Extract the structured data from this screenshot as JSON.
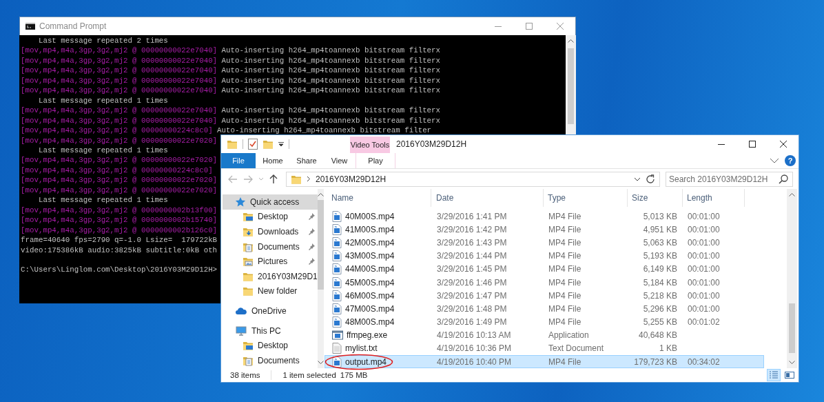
{
  "console": {
    "title": "Command Prompt",
    "lines": [
      {
        "kind": "message",
        "text": "    Last message repeated 2 times"
      },
      {
        "kind": "log",
        "source": "[mov,mp4,m4a,3gp,3g2,mj2 @ 00000000022e7040]",
        "message": "Auto-inserting h264_mp4toannexb bitstream filterx"
      },
      {
        "kind": "log",
        "source": "[mov,mp4,m4a,3gp,3g2,mj2 @ 00000000022e7040]",
        "message": "Auto-inserting h264_mp4toannexb bitstream filterx"
      },
      {
        "kind": "log",
        "source": "[mov,mp4,m4a,3gp,3g2,mj2 @ 00000000022e7040]",
        "message": "Auto-inserting h264_mp4toannexb bitstream filterx"
      },
      {
        "kind": "log",
        "source": "[mov,mp4,m4a,3gp,3g2,mj2 @ 00000000022e7040]",
        "message": "Auto-inserting h264_mp4toannexb bitstream filterx"
      },
      {
        "kind": "log",
        "source": "[mov,mp4,m4a,3gp,3g2,mj2 @ 00000000022e7040]",
        "message": "Auto-inserting h264_mp4toannexb bitstream filterx"
      },
      {
        "kind": "message",
        "text": "    Last message repeated 1 times"
      },
      {
        "kind": "log",
        "source": "[mov,mp4,m4a,3gp,3g2,mj2 @ 00000000022e7040]",
        "message": "Auto-inserting h264_mp4toannexb bitstream filterx"
      },
      {
        "kind": "log",
        "source": "[mov,mp4,m4a,3gp,3g2,mj2 @ 00000000022e7040]",
        "message": "Auto-inserting h264_mp4toannexb bitstream filterx"
      },
      {
        "kind": "log",
        "source": "[mov,mp4,m4a,3gp,3g2,mj2 @ 00000000224c8c0]",
        "message": "Auto-inserting h264_mp4toannexb bitstream filter"
      },
      {
        "kind": "log",
        "source": "[mov,mp4,m4a,3gp,3g2,mj2 @ 00000000022e7020]"
      },
      {
        "kind": "message",
        "text": "    Last message repeated 1 times"
      },
      {
        "kind": "log",
        "source": "[mov,mp4,m4a,3gp,3g2,mj2 @ 00000000022e7020]"
      },
      {
        "kind": "log",
        "source": "[mov,mp4,m4a,3gp,3g2,mj2 @ 00000000224c8c0]"
      },
      {
        "kind": "log",
        "source": "[mov,mp4,m4a,3gp,3g2,mj2 @ 00000000022e7020]"
      },
      {
        "kind": "log",
        "source": "[mov,mp4,m4a,3gp,3g2,mj2 @ 00000000022e7020]"
      },
      {
        "kind": "message",
        "text": "    Last message repeated 1 times"
      },
      {
        "kind": "log",
        "source": "[mov,mp4,m4a,3gp,3g2,mj2 @ 0000000002b13f00]"
      },
      {
        "kind": "log",
        "source": "[mov,mp4,m4a,3gp,3g2,mj2 @ 0000000002b15740]"
      },
      {
        "kind": "log",
        "source": "[mov,mp4,m4a,3gp,3g2,mj2 @ 0000000002b126c0]"
      },
      {
        "kind": "stats",
        "text": "frame=40640 fps=2790 q=-1.0 Lsize=  179722kB"
      },
      {
        "kind": "stats",
        "text": "video:175386kB audio:3825kB subtitle:0kB oth"
      },
      {
        "kind": "prompt",
        "text": "C:\\Users\\Linglom.com\\Desktop\\2016Y03M29D12H>"
      }
    ]
  },
  "explorer": {
    "title": "2016Y03M29D12H",
    "contextual_tab": "Video Tools",
    "ribbon_tabs": [
      {
        "label": "File",
        "kind": "file",
        "selected": false
      },
      {
        "label": "Home",
        "kind": "normal",
        "selected": false
      },
      {
        "label": "Share",
        "kind": "normal",
        "selected": false
      },
      {
        "label": "View",
        "kind": "normal",
        "selected": false
      },
      {
        "label": "Play",
        "kind": "contextual",
        "selected": false
      }
    ],
    "help_button": "?",
    "address": {
      "path": "2016Y03M29D12H"
    },
    "search": {
      "placeholder": "Search 2016Y03M29D12H"
    },
    "navigation": [
      {
        "label": "Quick access",
        "kind": "star",
        "selected": true,
        "children": [
          {
            "label": "Desktop",
            "kind": "desktop",
            "selected": false,
            "pinned": true
          },
          {
            "label": "Downloads",
            "kind": "downloads",
            "selected": false,
            "pinned": true
          },
          {
            "label": "Documents",
            "kind": "documents",
            "selected": false,
            "pinned": true
          },
          {
            "label": "Pictures",
            "kind": "pictures",
            "selected": false,
            "pinned": true
          },
          {
            "label": "2016Y03M29D1",
            "kind": "folder",
            "selected": false,
            "pinned": false
          },
          {
            "label": "New folder",
            "kind": "folder",
            "selected": false,
            "pinned": false
          }
        ]
      },
      {
        "label": "OneDrive",
        "kind": "cloud",
        "selected": false
      },
      {
        "label": "This PC",
        "kind": "pc",
        "selected": false,
        "children": [
          {
            "label": "Desktop",
            "kind": "desktop",
            "selected": false
          },
          {
            "label": "Documents",
            "kind": "documents",
            "selected": false
          }
        ]
      }
    ],
    "files": {
      "columns": [
        "Name",
        "Date",
        "Type",
        "Size",
        "Length"
      ],
      "rows": [
        {
          "kind": "video",
          "name": "40M00S.mp4",
          "date": "3/29/2016 1:41 PM",
          "type": "MP4 File",
          "size": "5,013 KB",
          "length": "00:01:00",
          "selected": false,
          "circled": false
        },
        {
          "kind": "video",
          "name": "41M00S.mp4",
          "date": "3/29/2016 1:42 PM",
          "type": "MP4 File",
          "size": "4,951 KB",
          "length": "00:01:00",
          "selected": false,
          "circled": false
        },
        {
          "kind": "video",
          "name": "42M00S.mp4",
          "date": "3/29/2016 1:43 PM",
          "type": "MP4 File",
          "size": "5,063 KB",
          "length": "00:01:00",
          "selected": false,
          "circled": false
        },
        {
          "kind": "video",
          "name": "43M00S.mp4",
          "date": "3/29/2016 1:44 PM",
          "type": "MP4 File",
          "size": "5,193 KB",
          "length": "00:01:00",
          "selected": false,
          "circled": false
        },
        {
          "kind": "video",
          "name": "44M00S.mp4",
          "date": "3/29/2016 1:45 PM",
          "type": "MP4 File",
          "size": "6,149 KB",
          "length": "00:01:00",
          "selected": false,
          "circled": false
        },
        {
          "kind": "video",
          "name": "45M00S.mp4",
          "date": "3/29/2016 1:46 PM",
          "type": "MP4 File",
          "size": "5,184 KB",
          "length": "00:01:00",
          "selected": false,
          "circled": false
        },
        {
          "kind": "video",
          "name": "46M00S.mp4",
          "date": "3/29/2016 1:47 PM",
          "type": "MP4 File",
          "size": "5,218 KB",
          "length": "00:01:00",
          "selected": false,
          "circled": false
        },
        {
          "kind": "video",
          "name": "47M00S.mp4",
          "date": "3/29/2016 1:48 PM",
          "type": "MP4 File",
          "size": "5,296 KB",
          "length": "00:01:00",
          "selected": false,
          "circled": false
        },
        {
          "kind": "video",
          "name": "48M00S.mp4",
          "date": "3/29/2016 1:49 PM",
          "type": "MP4 File",
          "size": "5,255 KB",
          "length": "00:01:02",
          "selected": false,
          "circled": false
        },
        {
          "kind": "application",
          "name": "ffmpeg.exe",
          "date": "4/19/2016 10:13 AM",
          "type": "Application",
          "size": "40,648 KB",
          "selected": false,
          "circled": false
        },
        {
          "kind": "text",
          "name": "mylist.txt",
          "date": "4/19/2016 10:36 PM",
          "type": "Text Document",
          "size": "1 KB",
          "selected": false,
          "circled": false
        },
        {
          "kind": "video",
          "name": "output.mp4",
          "date": "4/19/2016 10:40 PM",
          "type": "MP4 File",
          "size": "179,723 KB",
          "length": "00:34:02",
          "selected": true,
          "circled": true
        }
      ]
    },
    "status_bar": {
      "item_count": "38 items",
      "selection": "1 item selected",
      "selection_size": "175 MB"
    },
    "view_buttons": [
      {
        "kind": "details",
        "selected": true
      },
      {
        "kind": "tiles",
        "selected": false
      }
    ]
  }
}
